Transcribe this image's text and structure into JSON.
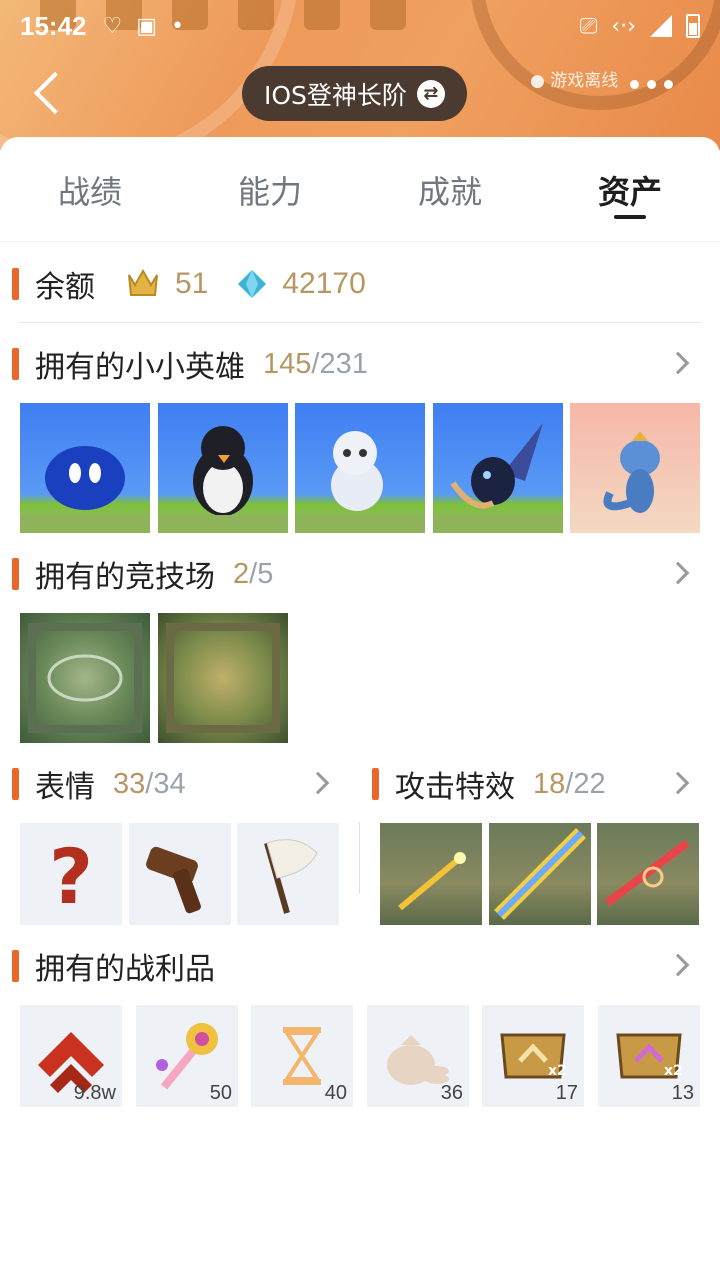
{
  "status_bar": {
    "time": "15:42"
  },
  "header": {
    "account_title": "IOS登神长阶",
    "offline_label": "游戏离线"
  },
  "tabs": [
    {
      "label": "战绩",
      "active": false
    },
    {
      "label": "能力",
      "active": false
    },
    {
      "label": "成就",
      "active": false
    },
    {
      "label": "资产",
      "active": true
    }
  ],
  "balance": {
    "label": "余额",
    "crown_value": "51",
    "gem_value": "42170"
  },
  "little_legends": {
    "title": "拥有的小小英雄",
    "owned": "145",
    "total": "231",
    "items": [
      "blue-slime-legend",
      "penguin-legend",
      "white-cat-legend",
      "dark-moth-legend",
      "dragon-legend"
    ]
  },
  "arenas": {
    "title": "拥有的竞技场",
    "owned": "2",
    "total": "5"
  },
  "emotes": {
    "title": "表情",
    "owned": "33",
    "total": "34"
  },
  "attack_effects": {
    "title": "攻击特效",
    "owned": "18",
    "total": "22"
  },
  "loot": {
    "title": "拥有的战利品",
    "items": [
      {
        "icon": "rank-chevron-icon",
        "count": "9.8w"
      },
      {
        "icon": "magic-scepter-icon",
        "count": "50"
      },
      {
        "icon": "hourglass-icon",
        "count": "40"
      },
      {
        "icon": "money-bag-icon",
        "count": "36"
      },
      {
        "icon": "double-xp-badge-icon",
        "count": "17"
      },
      {
        "icon": "double-xp-badge-purple-icon",
        "count": "13"
      }
    ]
  },
  "colors": {
    "accent": "#e8682c",
    "count_gold": "#b69764",
    "pill_bg": "#4a3a30"
  }
}
